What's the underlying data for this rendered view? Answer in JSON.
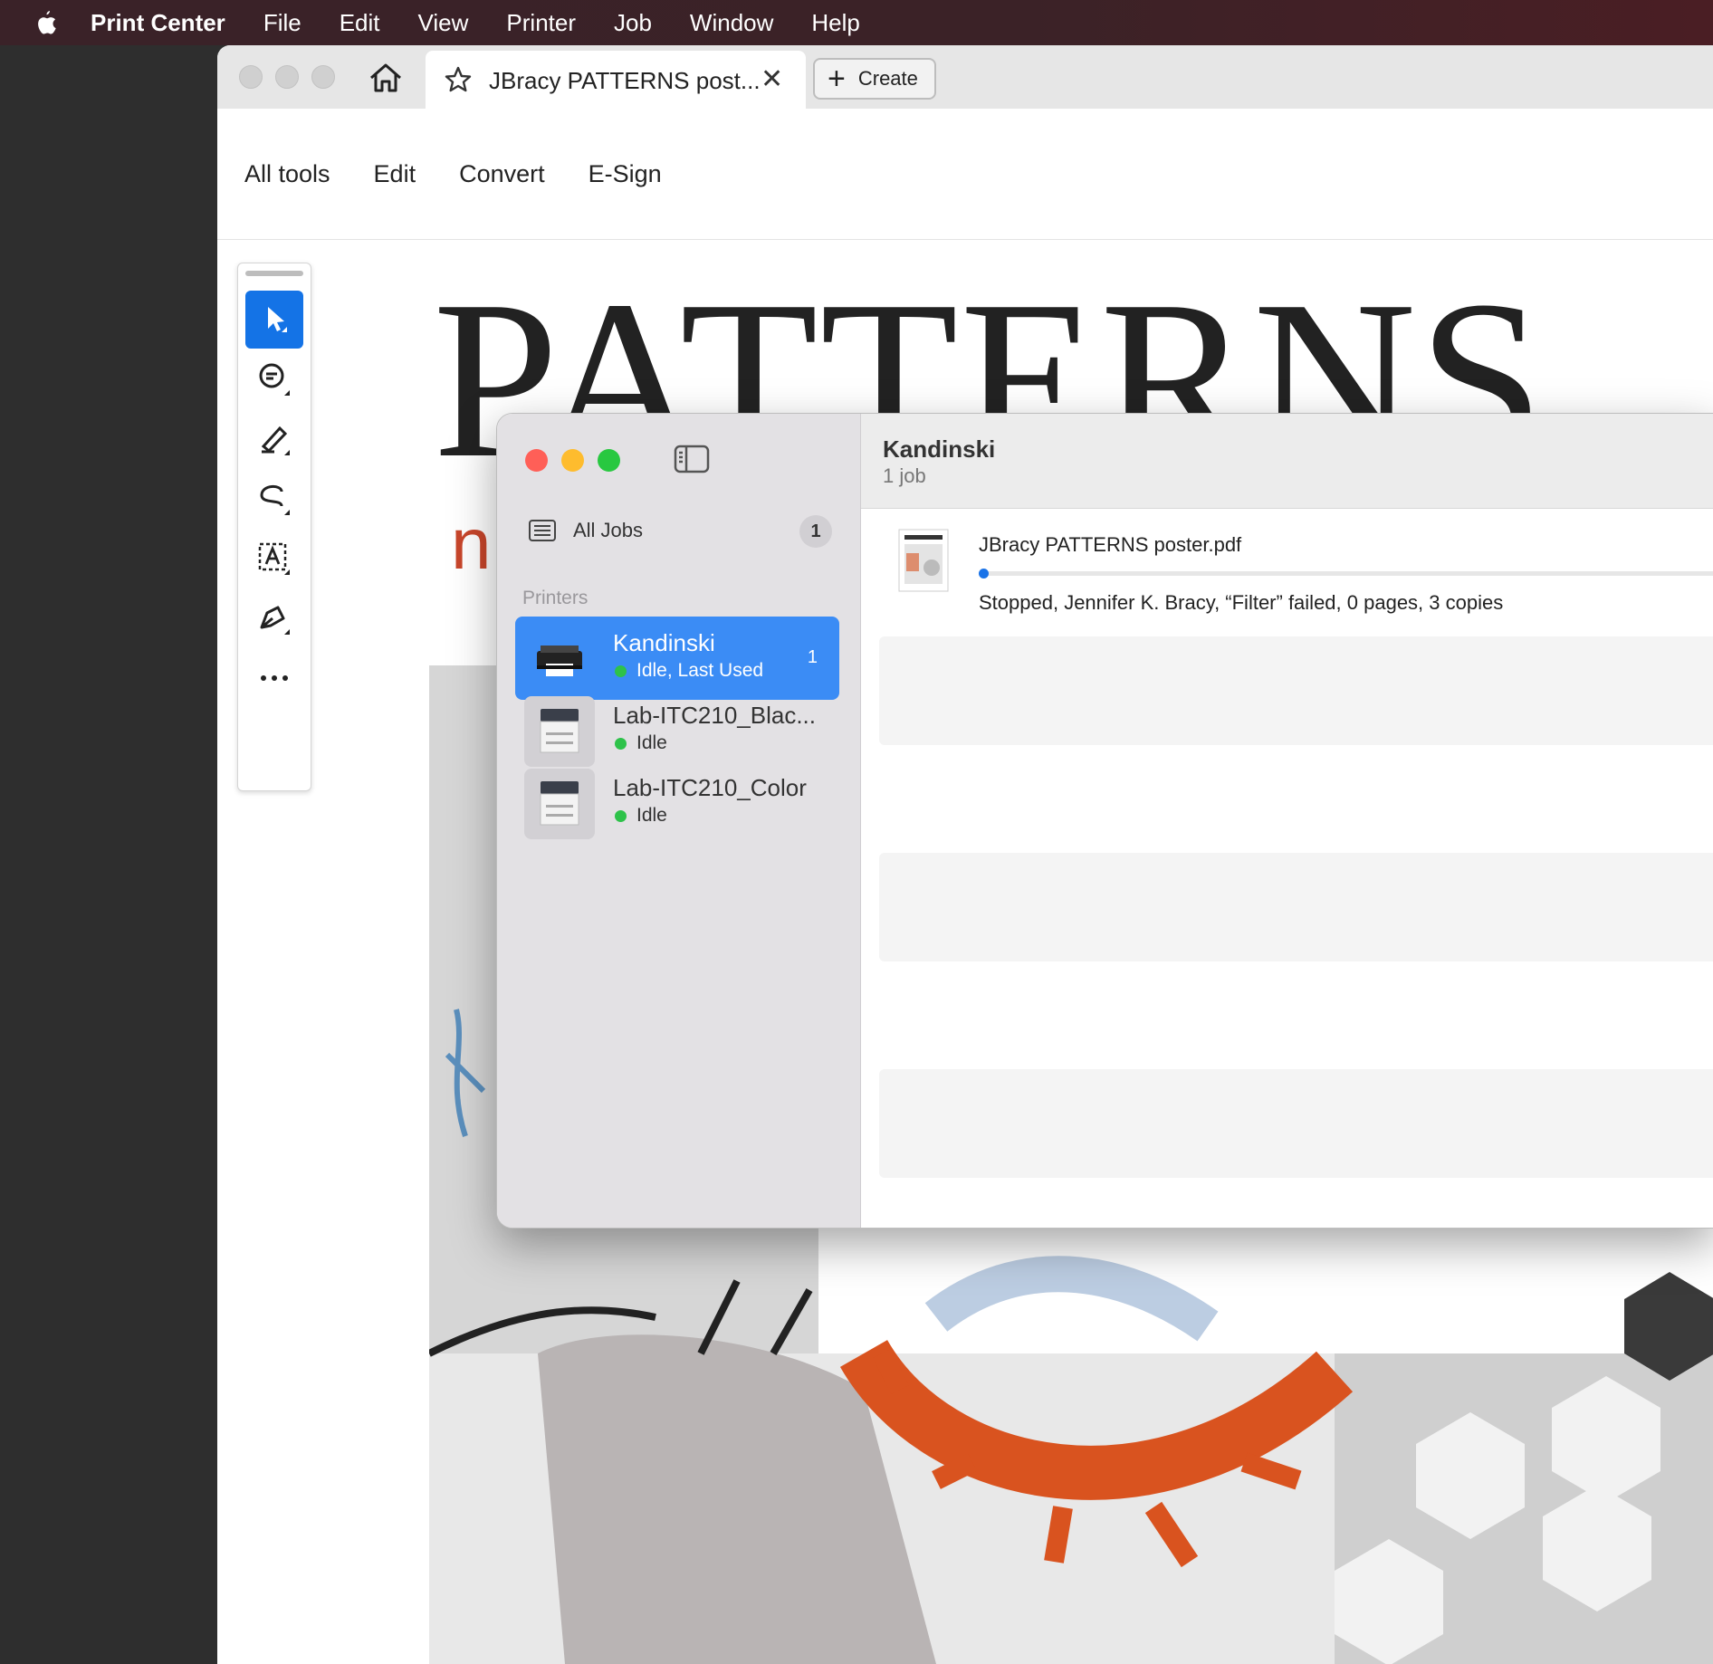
{
  "menubar": {
    "app": "Print Center",
    "items": [
      "File",
      "Edit",
      "View",
      "Printer",
      "Job",
      "Window",
      "Help"
    ]
  },
  "acrobat": {
    "tab_title": "JBracy PATTERNS post...",
    "create_label": "Create",
    "toolbar": [
      "All tools",
      "Edit",
      "Convert",
      "E-Sign"
    ],
    "quick_tools": [
      "select-icon",
      "comment-icon",
      "highlight-icon",
      "draw-icon",
      "text-box-icon",
      "signature-icon",
      "more-icon"
    ],
    "accent": "#1473e6"
  },
  "document": {
    "title": "PATTERNS",
    "partial_letter": "n"
  },
  "print_center": {
    "all_jobs_label": "All Jobs",
    "all_jobs_count": "1",
    "printers_label": "Printers",
    "printers": [
      {
        "name": "Kandinski",
        "status": "Idle, Last Used",
        "count": "1",
        "selected": true
      },
      {
        "name": "Lab-ITC210_Blac...",
        "status": "Idle",
        "count": "",
        "selected": false
      },
      {
        "name": "Lab-ITC210_Color",
        "status": "Idle",
        "count": "",
        "selected": false
      }
    ],
    "header_title": "Kandinski",
    "header_subtitle": "1 job",
    "job": {
      "filename": "JBracy PATTERNS poster.pdf",
      "status": "Stopped, Jennifer K. Bracy, “Filter”  failed, 0 pages, 3 copies"
    },
    "selection_color": "#3b8cf5",
    "status_dot_color": "#2ec24a"
  }
}
